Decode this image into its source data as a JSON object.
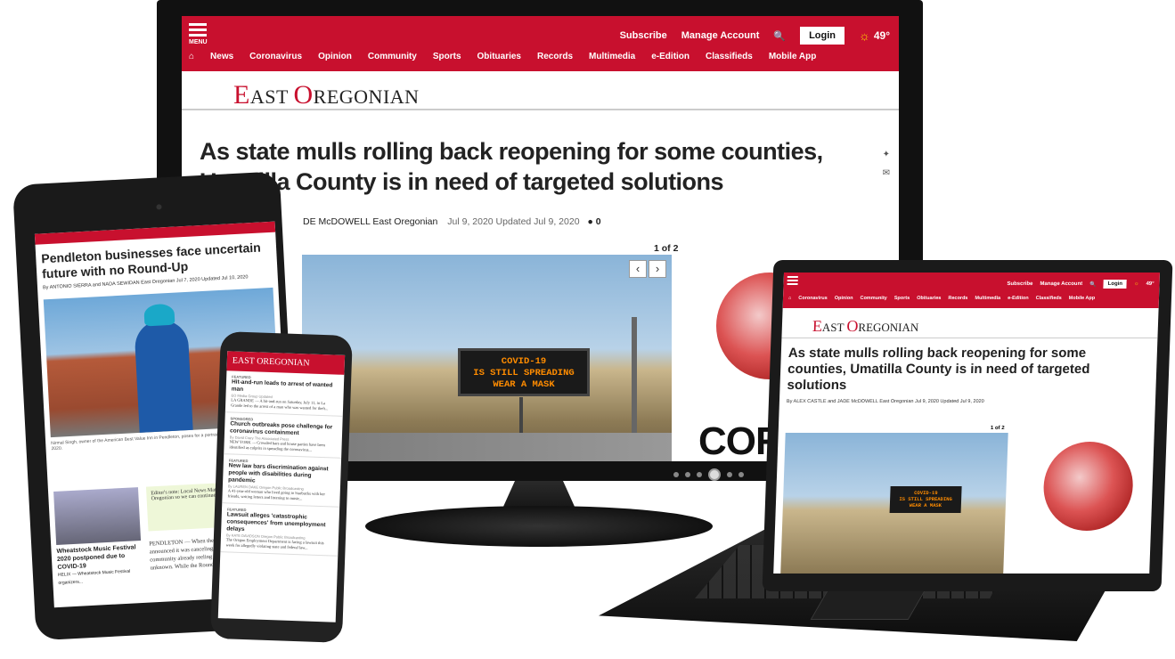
{
  "site": {
    "logo_first": "E",
    "logo_rest1": "AST ",
    "logo_second": "O",
    "logo_rest2": "REGONIAN",
    "brand_color": "#c8102e"
  },
  "monitor": {
    "menu_label": "MENU",
    "subscribe": "Subscribe",
    "manage_account": "Manage Account",
    "login": "Login",
    "temperature": "49°",
    "nav": [
      "News",
      "Coronavirus",
      "Opinion",
      "Community",
      "Sports",
      "Obituaries",
      "Records",
      "Multimedia",
      "e-Edition",
      "Classifieds",
      "Mobile App"
    ],
    "headline": "As state mulls rolling back reopening for some counties, Umatilla County is in need of targeted solutions",
    "byline": "DE McDOWELL East Oregonian",
    "dates": "Jul 9, 2020 Updated Jul 9, 2020",
    "comments": "0",
    "counter": "1 of 2",
    "sign_line1": "COVID-19",
    "sign_line2": "IS STILL SPREADING",
    "sign_line3": "WEAR A MASK",
    "ad_text": "CORO"
  },
  "tablet": {
    "headline": "Pendleton businesses face uncertain future with no Round-Up",
    "byline": "By ANTONIO SIERRA and NADA SEWIDAN East Oregonian  Jul 7, 2020 Updated Jul 10, 2020",
    "caption": "Nirmal Singh, owner of the American Best Value Inn in Pendleton, poses for a portrait at the hotel on Monday, July 6, 2020.",
    "note": "Editor's note: Local News Matters. Please support East Oregonian so we can continue reporting. Thank you.",
    "side_title": "Wheatstock Music Festival 2020 postponed due to COVID-19",
    "side_text": "HELIX — Wheatstock Music Festival organizers...",
    "body": "PENDLETON — When the Pendleton Round-Up announced it was canceling its 2020 rodeo, the community already reeling from an economic... the unknown. While the Round-Up is raising funds for..."
  },
  "phone": {
    "articles": [
      {
        "tag": "FEATURED",
        "title": "Hit-and-run leads to arrest of wanted man",
        "meta": "EO Media Group  Updated",
        "text": "LA GRANDE — A hit-and-run on Saturday, July 11, in La Grande led to the arrest of a man who was wanted for theft..."
      },
      {
        "tag": "SPONSORED",
        "title": "Church outbreaks pose challenge for coronavirus containment",
        "meta": "By David Crary The Associated Press",
        "text": "NEW YORK — Crowded bars and house parties have been identified as culprits in spreading the coronavirus..."
      },
      {
        "tag": "FEATURED",
        "title": "New law bars discrimination against people with disabilities during pandemic",
        "meta": "By LAUREN DAKE Oregon Public Broadcasting",
        "text": "A 41-year-old woman who lived going to Starbucks with her friends, writing letters and listening to music..."
      },
      {
        "tag": "FEATURED",
        "title": "Lawsuit alleges 'catastrophic consequences' from unemployment delays",
        "meta": "By KATE DAVIDSON Oregon Public Broadcasting",
        "text": "The Oregon Employment Department is facing a lawsuit this week for allegedly violating state and federal law..."
      }
    ]
  },
  "laptop": {
    "subscribe": "Subscribe",
    "manage_account": "Manage Account",
    "login": "Login",
    "temperature": "49°",
    "nav": [
      "Coronavirus",
      "Opinion",
      "Community",
      "Sports",
      "Obituaries",
      "Records",
      "Multimedia",
      "e-Edition",
      "Classifieds",
      "Mobile App"
    ],
    "headline": "As state mulls rolling back reopening for some counties, Umatilla County is in need of targeted solutions",
    "byline": "By ALEX CASTLE and JADE McDOWELL East Oregonian  Jul 9, 2020 Updated Jul 9, 2020",
    "counter": "1 of 2",
    "sign_line1": "COVID-19",
    "sign_line2": "IS STILL SPREADING",
    "sign_line3": "WEAR A MASK"
  }
}
